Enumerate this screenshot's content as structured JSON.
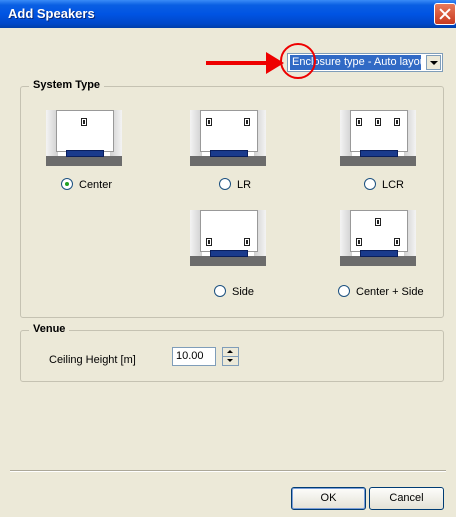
{
  "window": {
    "title": "Add Speakers"
  },
  "enclosure_dropdown": {
    "selected": "Enclosure type - Auto layout"
  },
  "system_type": {
    "legend": "System Type",
    "options": [
      {
        "label": "Center",
        "checked": true
      },
      {
        "label": "LR",
        "checked": false
      },
      {
        "label": "LCR",
        "checked": false
      },
      {
        "label": "Side",
        "checked": false
      },
      {
        "label": "Center + Side",
        "checked": false
      }
    ]
  },
  "venue": {
    "legend": "Venue",
    "ceiling_label": "Ceiling Height [m]",
    "ceiling_value": "10.00"
  },
  "buttons": {
    "ok": "OK",
    "cancel": "Cancel"
  },
  "colors": {
    "titlebar": "#0054e3",
    "dialog_bg": "#ece9d8",
    "annotation_red": "#e00000",
    "stage_blue": "#1a3a8c"
  }
}
